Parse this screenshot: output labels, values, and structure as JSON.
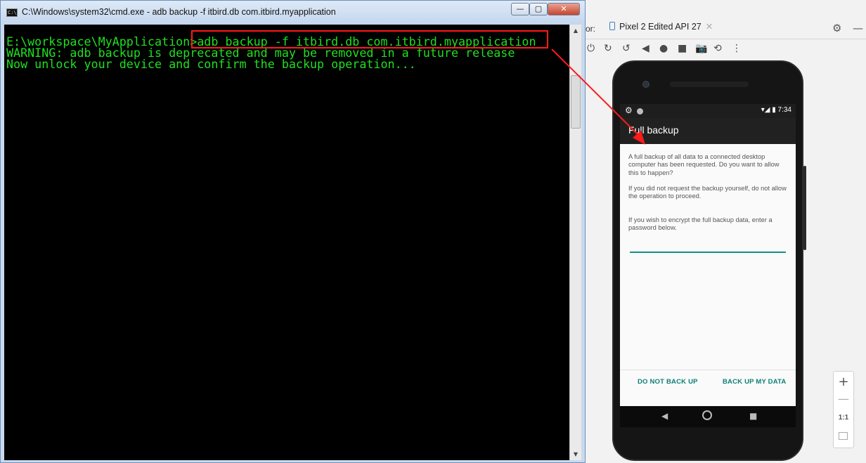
{
  "cmd": {
    "icon_label": "C:\\.",
    "title": "C:\\Windows\\system32\\cmd.exe - adb  backup -f itbird.db com.itbird.myapplication",
    "min": "—",
    "max": "▢",
    "close": "✕",
    "lines": [
      "E:\\workspace\\MyApplication>adb backup -f itbird.db com.itbird.myapplication",
      "WARNING: adb backup is deprecated and may be removed in a future release",
      "Now unlock your device and confirm the backup operation..."
    ],
    "scroll_up": "▲",
    "scroll_down": "▼"
  },
  "emulator": {
    "label_fragment": "or:",
    "tab_label": "Pixel 2 Edited API 27",
    "tab_close": "✕",
    "settings_icon": "⚙",
    "minimize_icon": "—",
    "toolbar": [
      "⏻",
      "↻",
      "↺",
      "◀",
      "●",
      "■",
      "📷",
      "⟲",
      "⋮"
    ],
    "status_time": "▾◢ ▮ 7:34",
    "appbar_title": "Full backup",
    "message1": "A full backup of all data to a connected desktop computer has been requested. Do you want to allow this to happen?",
    "message2": "If you did not request the backup yourself, do not allow the operation to proceed.",
    "message3": "If you wish to encrypt the full backup data, enter a password below.",
    "button_no": "DO NOT BACK UP",
    "button_yes": "BACK UP MY DATA",
    "zoom_in": "+",
    "zoom_out": "—",
    "zoom_reset": "1:1"
  },
  "colors": {
    "terminal_text": "#1fe01f",
    "highlight": "#ff1a1a",
    "accent": "#0c8076"
  }
}
